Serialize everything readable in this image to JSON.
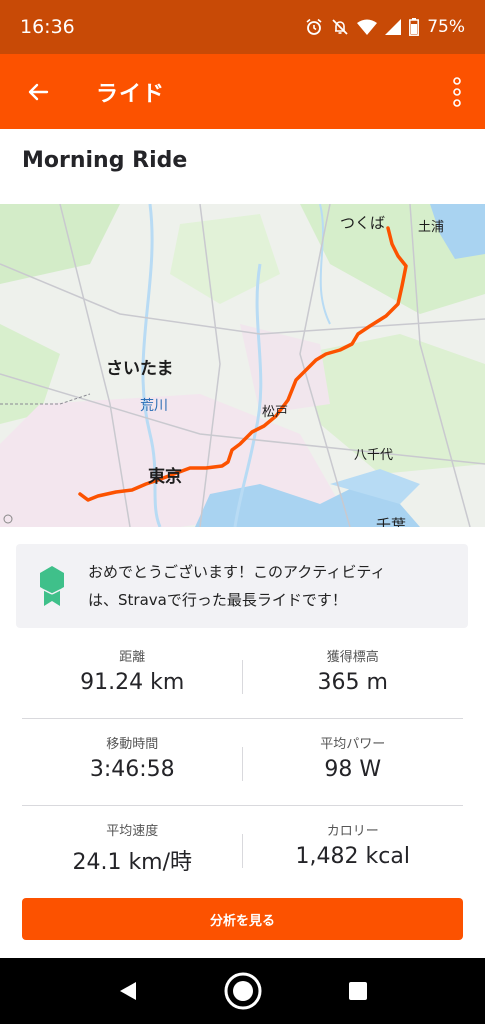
{
  "status_bar": {
    "time": "16:36",
    "battery": "75%",
    "icons": [
      "alarm-icon",
      "mute-icon",
      "wifi-icon",
      "signal-icon",
      "battery-icon"
    ]
  },
  "app_bar": {
    "title": "ライド",
    "back_icon": "arrow-left-icon",
    "menu_icon": "more-vertical-icon"
  },
  "activity": {
    "title": "Morning Ride"
  },
  "map": {
    "labels": {
      "tsukuba": "つくば",
      "tsuchiura": "土浦",
      "saitama": "さいたま",
      "arakawa": "荒川",
      "matsudo": "松戸",
      "yachiyo": "八千代",
      "tokyo": "東京",
      "chiba": "千葉"
    },
    "route_color": "#fc5200"
  },
  "achievement": {
    "icon": "award-badge-icon",
    "text_line1": "おめでとうございます！このアクティビティ",
    "text_line2": "は、Stravaで行った最長ライドです！"
  },
  "stats": [
    {
      "left_label": "距離",
      "left_value": "91.24 km",
      "right_label": "獲得標高",
      "right_value": "365 m"
    },
    {
      "left_label": "移動時間",
      "left_value": "3:46:58",
      "right_label": "平均パワー",
      "right_value": "98 W"
    },
    {
      "left_label": "平均速度",
      "left_value": "24.1 km/時",
      "right_label": "カロリー",
      "right_value": "1,482 kcal"
    }
  ],
  "analyze_button": "分析を見る",
  "colors": {
    "accent": "#fc5200",
    "status_bar": "#c84a06",
    "achievement_icon": "#3fc08a"
  }
}
